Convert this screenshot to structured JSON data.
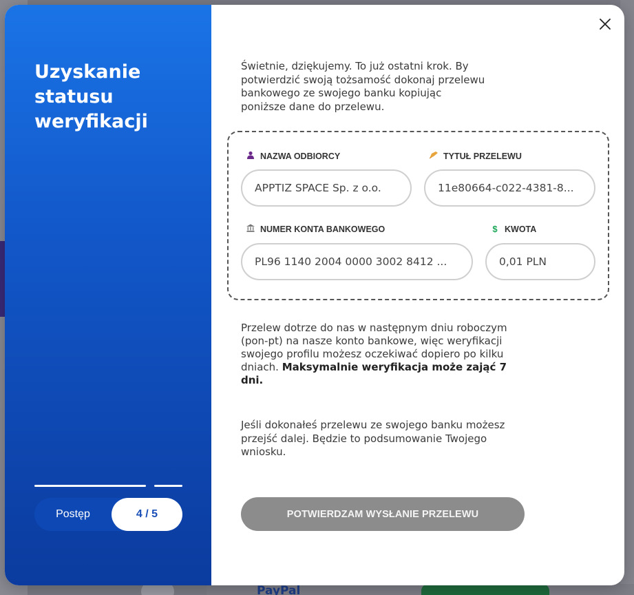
{
  "modal": {
    "title": "Uzyskanie statusu weryfikacji",
    "progress": {
      "label": "Postęp",
      "value": "4 / 5"
    },
    "intro": "Świetnie, dziękujemy. To już ostatni krok. By potwierdzić swoją tożsamość dokonaj przelewu bankowego ze swojego banku kopiując poniższe dane do przelewu.",
    "fields": {
      "recipient": {
        "label": "NAZWA ODBIORCY",
        "value": "APPTIZ SPACE Sp. z o.o.",
        "icon": "person-icon",
        "icon_color": "#6b2a8a"
      },
      "transfer_title": {
        "label": "TYTUŁ PRZELEWU",
        "value": "11e80664-c022-4381-8...",
        "icon": "writing-hand-icon",
        "icon_color": "#e7a43a"
      },
      "account_number": {
        "label": "NUMER KONTA BANKOWEGO",
        "value": "PL96 1140 2004 0000 3002 8412 ...",
        "icon": "bank-icon",
        "icon_color": "#777777"
      },
      "amount": {
        "label": "KWOTA",
        "value": "0,01 PLN",
        "icon": "dollar-icon",
        "icon_color": "#1fa85a"
      }
    },
    "info_text_plain": "Przelew dotrze do nas w następnym dniu roboczym (pon-pt) na nasze konto bankowe, więc weryfikacji swojego profilu możesz oczekiwać dopiero po kilku dniach.",
    "info_text_bold": "Maksymalnie weryfikacja może zająć 7 dni.",
    "info_text2": "Jeśli dokonałeś przelewu ze swojego banku możesz przejść dalej. Będzie to podsumowanie Twojego wniosku.",
    "confirm_button": "POTWIERDZAM WYSŁANIE PRZELEWU"
  },
  "background": {
    "fragment_bottom": "PayPal"
  },
  "colors": {
    "gradient_top": "#1a74e6",
    "gradient_bottom": "#0b3b9e",
    "button_disabled": "#8c8c8c"
  }
}
